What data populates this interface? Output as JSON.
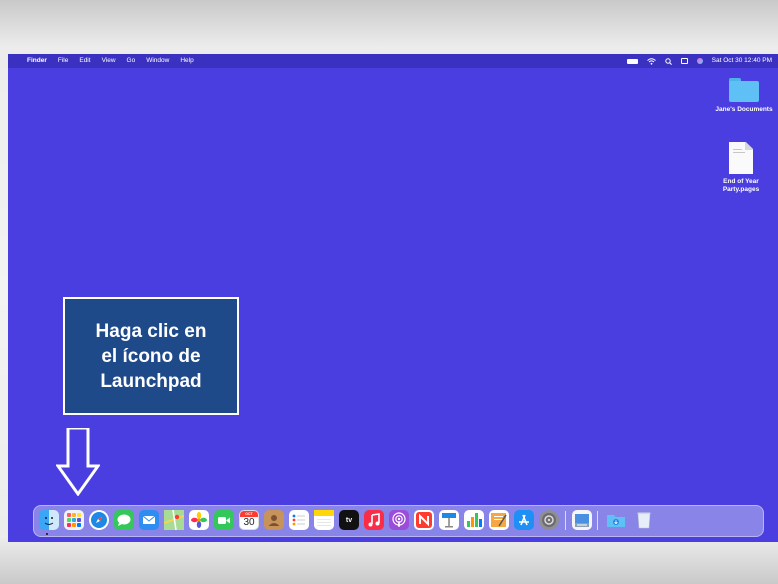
{
  "menubar": {
    "apple": "",
    "app_name": "Finder",
    "menus": [
      "File",
      "Edit",
      "View",
      "Go",
      "Window",
      "Help"
    ],
    "clock": "Sat Oct 30  12:40 PM"
  },
  "desktop": {
    "folder_label": "Jane's Documents",
    "file_label_line1": "End of Year",
    "file_label_line2": "Party.pages"
  },
  "callout": {
    "text": "Haga clic en\nel ícono de\nLaunchpad"
  },
  "dock": {
    "calendar_month": "OCT",
    "calendar_day": "30",
    "tv_label": "tv"
  },
  "colors": {
    "desktop": "#4a3ee0",
    "callout": "#1f4a8a"
  }
}
